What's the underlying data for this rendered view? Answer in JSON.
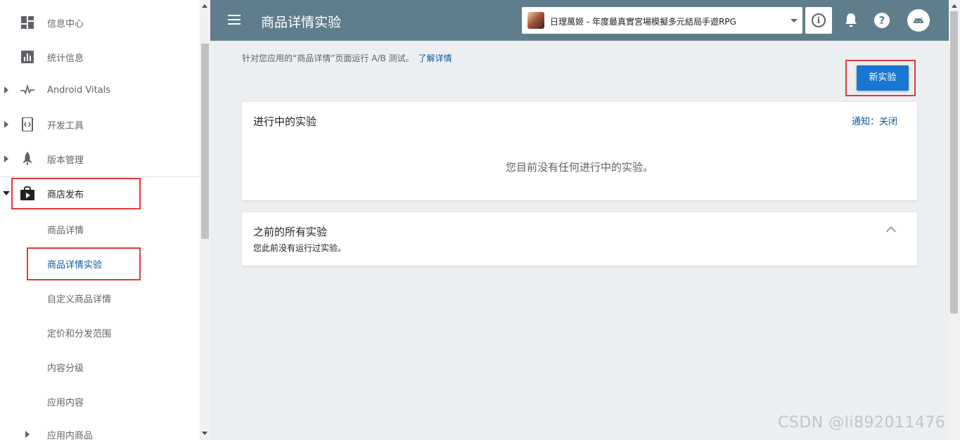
{
  "sidebar": {
    "items": [
      {
        "label": "信息中心",
        "icon": "dashboard-icon"
      },
      {
        "label": "统计信息",
        "icon": "bar-chart-icon"
      },
      {
        "label": "Android Vitals",
        "icon": "pulse-icon"
      },
      {
        "label": "开发工具",
        "icon": "code-brackets-icon"
      },
      {
        "label": "版本管理",
        "icon": "rocket-icon"
      },
      {
        "label": "商店发布",
        "icon": "play-store-bag-icon"
      },
      {
        "label": "商品详情"
      },
      {
        "label": "商品详情实验"
      },
      {
        "label": "自定义商品详情"
      },
      {
        "label": "定价和分发范围"
      },
      {
        "label": "内容分级"
      },
      {
        "label": "应用内容"
      },
      {
        "label": "应用内商品"
      }
    ]
  },
  "header": {
    "title": "商品详情实验",
    "app_name": "日理萬姬 - 年度最真實宮場模擬多元結局手遊RPG"
  },
  "main": {
    "intro_text": "针对您应用的“商品详情”页面运行 A/B 测试。",
    "learn_more": "了解详情",
    "new_experiment_label": "新实验",
    "active_card": {
      "title": "进行中的实验",
      "notify_label": "通知：关闭",
      "empty_text": "您目前没有任何进行中的实验。"
    },
    "past_card": {
      "title": "之前的所有实验",
      "subtitle": "您此前没有运行过实验。"
    }
  },
  "watermark": "CSDN @li892011476",
  "colors": {
    "header_bg": "#607d8b",
    "primary_button": "#1976d2",
    "link": "#0b57a1",
    "highlight_box": "#e53935",
    "main_bg": "#eceff1"
  }
}
